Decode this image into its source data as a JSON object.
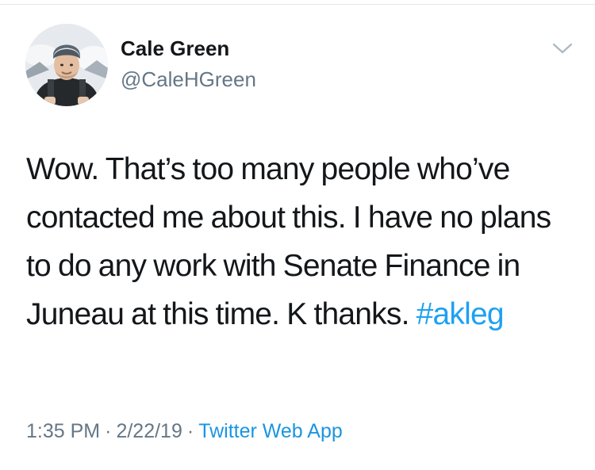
{
  "user": {
    "name": "Cale Green",
    "handle": "@CaleHGreen"
  },
  "tweet": {
    "text": "Wow. That’s too many people who’ve contacted me about this. I have no plans to do any work with Senate Finance in Juneau at this time. K thanks. ",
    "hashtag": "#akleg",
    "time": "1:35 PM",
    "date": "2/22/19",
    "separator": "·",
    "source": "Twitter Web App"
  },
  "icons": {
    "menu": "chevron-down-icon",
    "avatar": "profile-photo"
  },
  "colors": {
    "text": "#14171a",
    "secondary": "#657786",
    "link": "#1da1f2",
    "divider": "#e1e8ed"
  }
}
